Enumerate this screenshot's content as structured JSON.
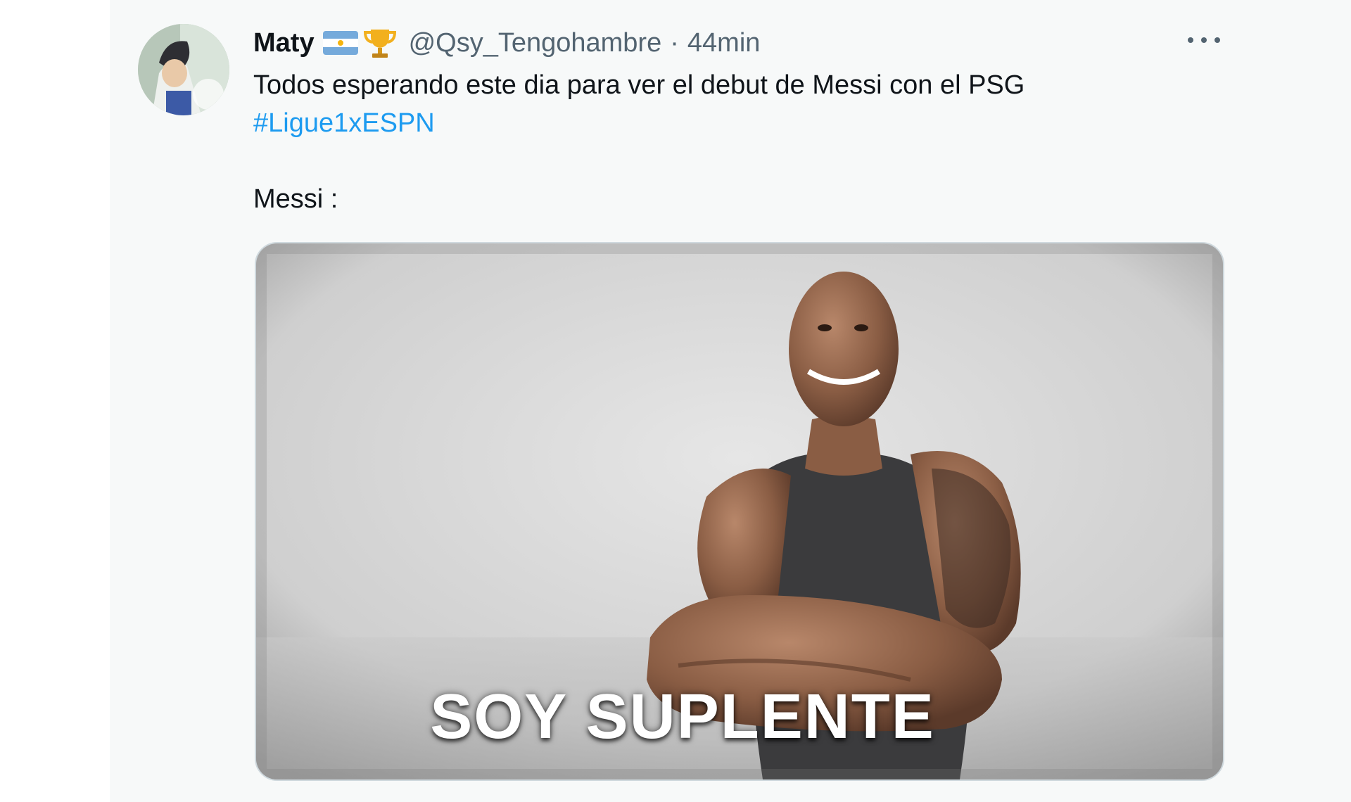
{
  "tweet": {
    "display_name": "Maty",
    "name_emojis": [
      "argentina-flag",
      "trophy"
    ],
    "handle": "@Qsy_Tengohambre",
    "separator": "·",
    "time": "44min",
    "text_line1": "Todos esperando este dia para ver el debut de Messi con el PSG",
    "hashtag": "#Ligue1xESPN",
    "text_line3": "Messi :",
    "media_caption": "SOY SUPLENTE"
  },
  "colors": {
    "background": "#f7f9f9",
    "text": "#0f1419",
    "secondary": "#536471",
    "link": "#1d9bf0"
  }
}
